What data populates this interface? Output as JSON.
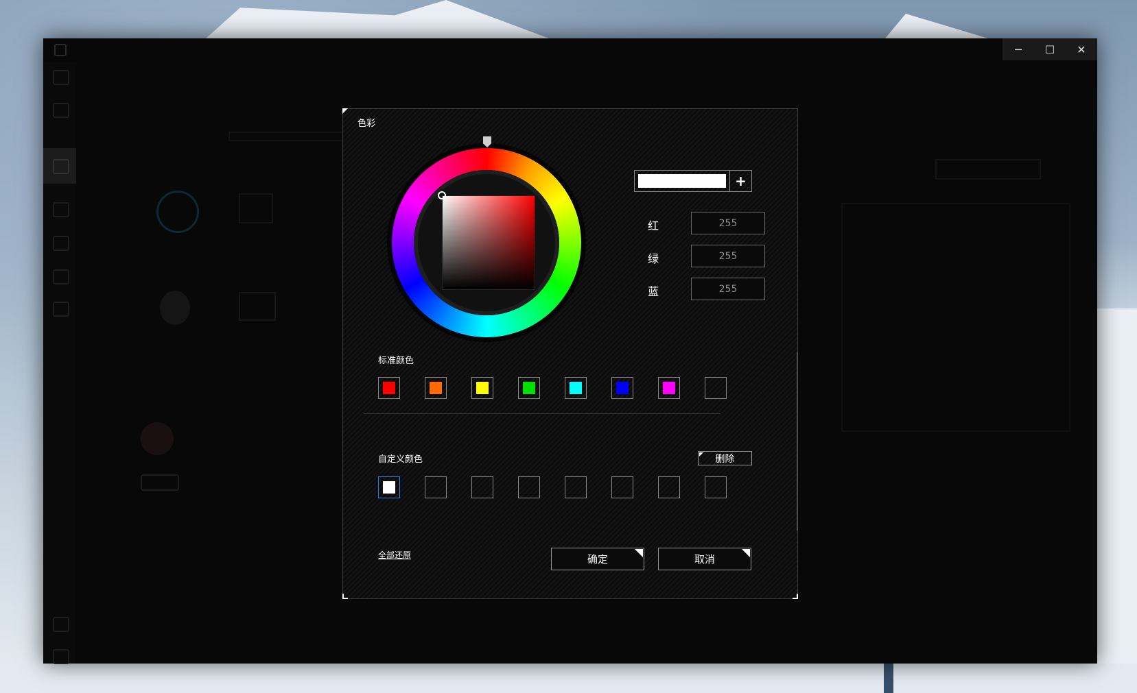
{
  "window": {
    "controls": {
      "minimize": "─",
      "maximize": "☐",
      "close": "✕"
    }
  },
  "dialog": {
    "title": "色彩",
    "preview": {
      "color": "#ffffff",
      "add_label": "+"
    },
    "rgb": {
      "red_label": "红",
      "red_value": "255",
      "green_label": "绿",
      "green_value": "255",
      "blue_label": "蓝",
      "blue_value": "255"
    },
    "standard_colors": {
      "label": "标准颜色",
      "colors": [
        "#ff0000",
        "#ff6a00",
        "#ffff00",
        "#00e000",
        "#00ffff",
        "#0000ff",
        "#ff00ff",
        ""
      ]
    },
    "custom_colors": {
      "label": "自定义颜色",
      "delete_label": "删除",
      "colors": [
        "#ffffff",
        "",
        "",
        "",
        "",
        "",
        "",
        ""
      ]
    },
    "reset_label": "全部还原",
    "ok_label": "确定",
    "cancel_label": "取消"
  }
}
